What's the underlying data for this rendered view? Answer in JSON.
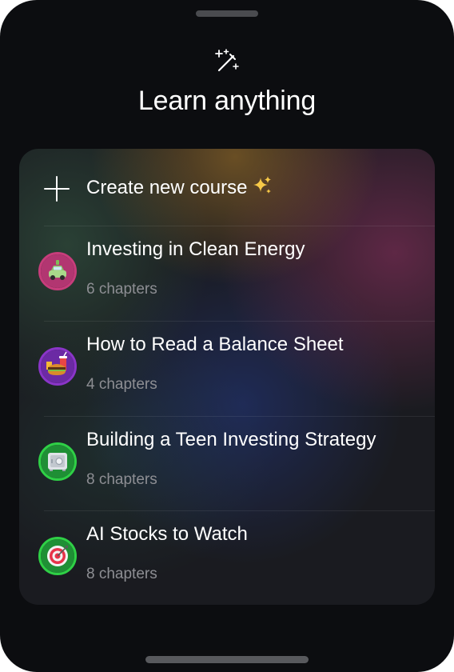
{
  "header": {
    "title": "Learn anything",
    "icon": "magic-wand-icon"
  },
  "create": {
    "label": "Create new course",
    "icon": "plus-icon",
    "emoji": "sparkles-icon"
  },
  "courses": [
    {
      "title": "Investing in Clean Energy",
      "chapters": "6 chapters",
      "icon": "electric-car-icon",
      "color": "#c73d7b"
    },
    {
      "title": "How to Read a Balance Sheet",
      "chapters": "4 chapters",
      "icon": "fast-food-icon",
      "color": "#8a35c8"
    },
    {
      "title": "Building a Teen Investing Strategy",
      "chapters": "8 chapters",
      "icon": "safe-icon",
      "color": "#2fd046"
    },
    {
      "title": "AI Stocks to Watch",
      "chapters": "8 chapters",
      "icon": "target-icon",
      "color": "#2fd046"
    }
  ],
  "colors": {
    "background": "#0c0d10",
    "text": "#ffffff",
    "subtext": "#8d8e93"
  }
}
